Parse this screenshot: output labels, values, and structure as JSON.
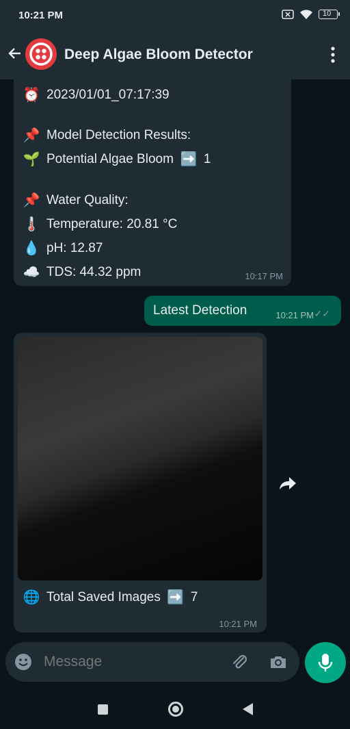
{
  "status": {
    "time": "10:21 PM",
    "battery": "10"
  },
  "header": {
    "title": "Deep Algae Bloom Detector"
  },
  "messages": {
    "m1": {
      "timestamp_line": "2023/01/01_07:17:39",
      "model_heading": "Model Detection Results:",
      "algae_label": "Potential Algae Bloom",
      "algae_value": "1",
      "water_heading": "Water Quality:",
      "temperature": "Temperature: 20.81 °C",
      "ph": "pH: 12.87",
      "tds": "TDS: 44.32  ppm",
      "time": "10:17 PM"
    },
    "m2": {
      "text": "Latest Detection",
      "time": "10:21 PM"
    },
    "m3": {
      "saved_label": "Total Saved Images",
      "saved_value": "7",
      "time": "10:21 PM"
    }
  },
  "composer": {
    "placeholder": "Message"
  },
  "icons": {
    "clock": "alarm-clock-icon",
    "pin": "pushpin-icon",
    "seedling": "seedling-icon",
    "arrow": "right-arrow-icon",
    "thermometer": "thermometer-icon",
    "droplet": "droplet-icon",
    "cloud": "cloud-icon",
    "globe": "globe-icon"
  },
  "colors": {
    "accent": "#00a884",
    "outgoing_bubble": "#005c4b",
    "incoming_bubble": "#1f2c34",
    "avatar": "#e33b3f"
  }
}
